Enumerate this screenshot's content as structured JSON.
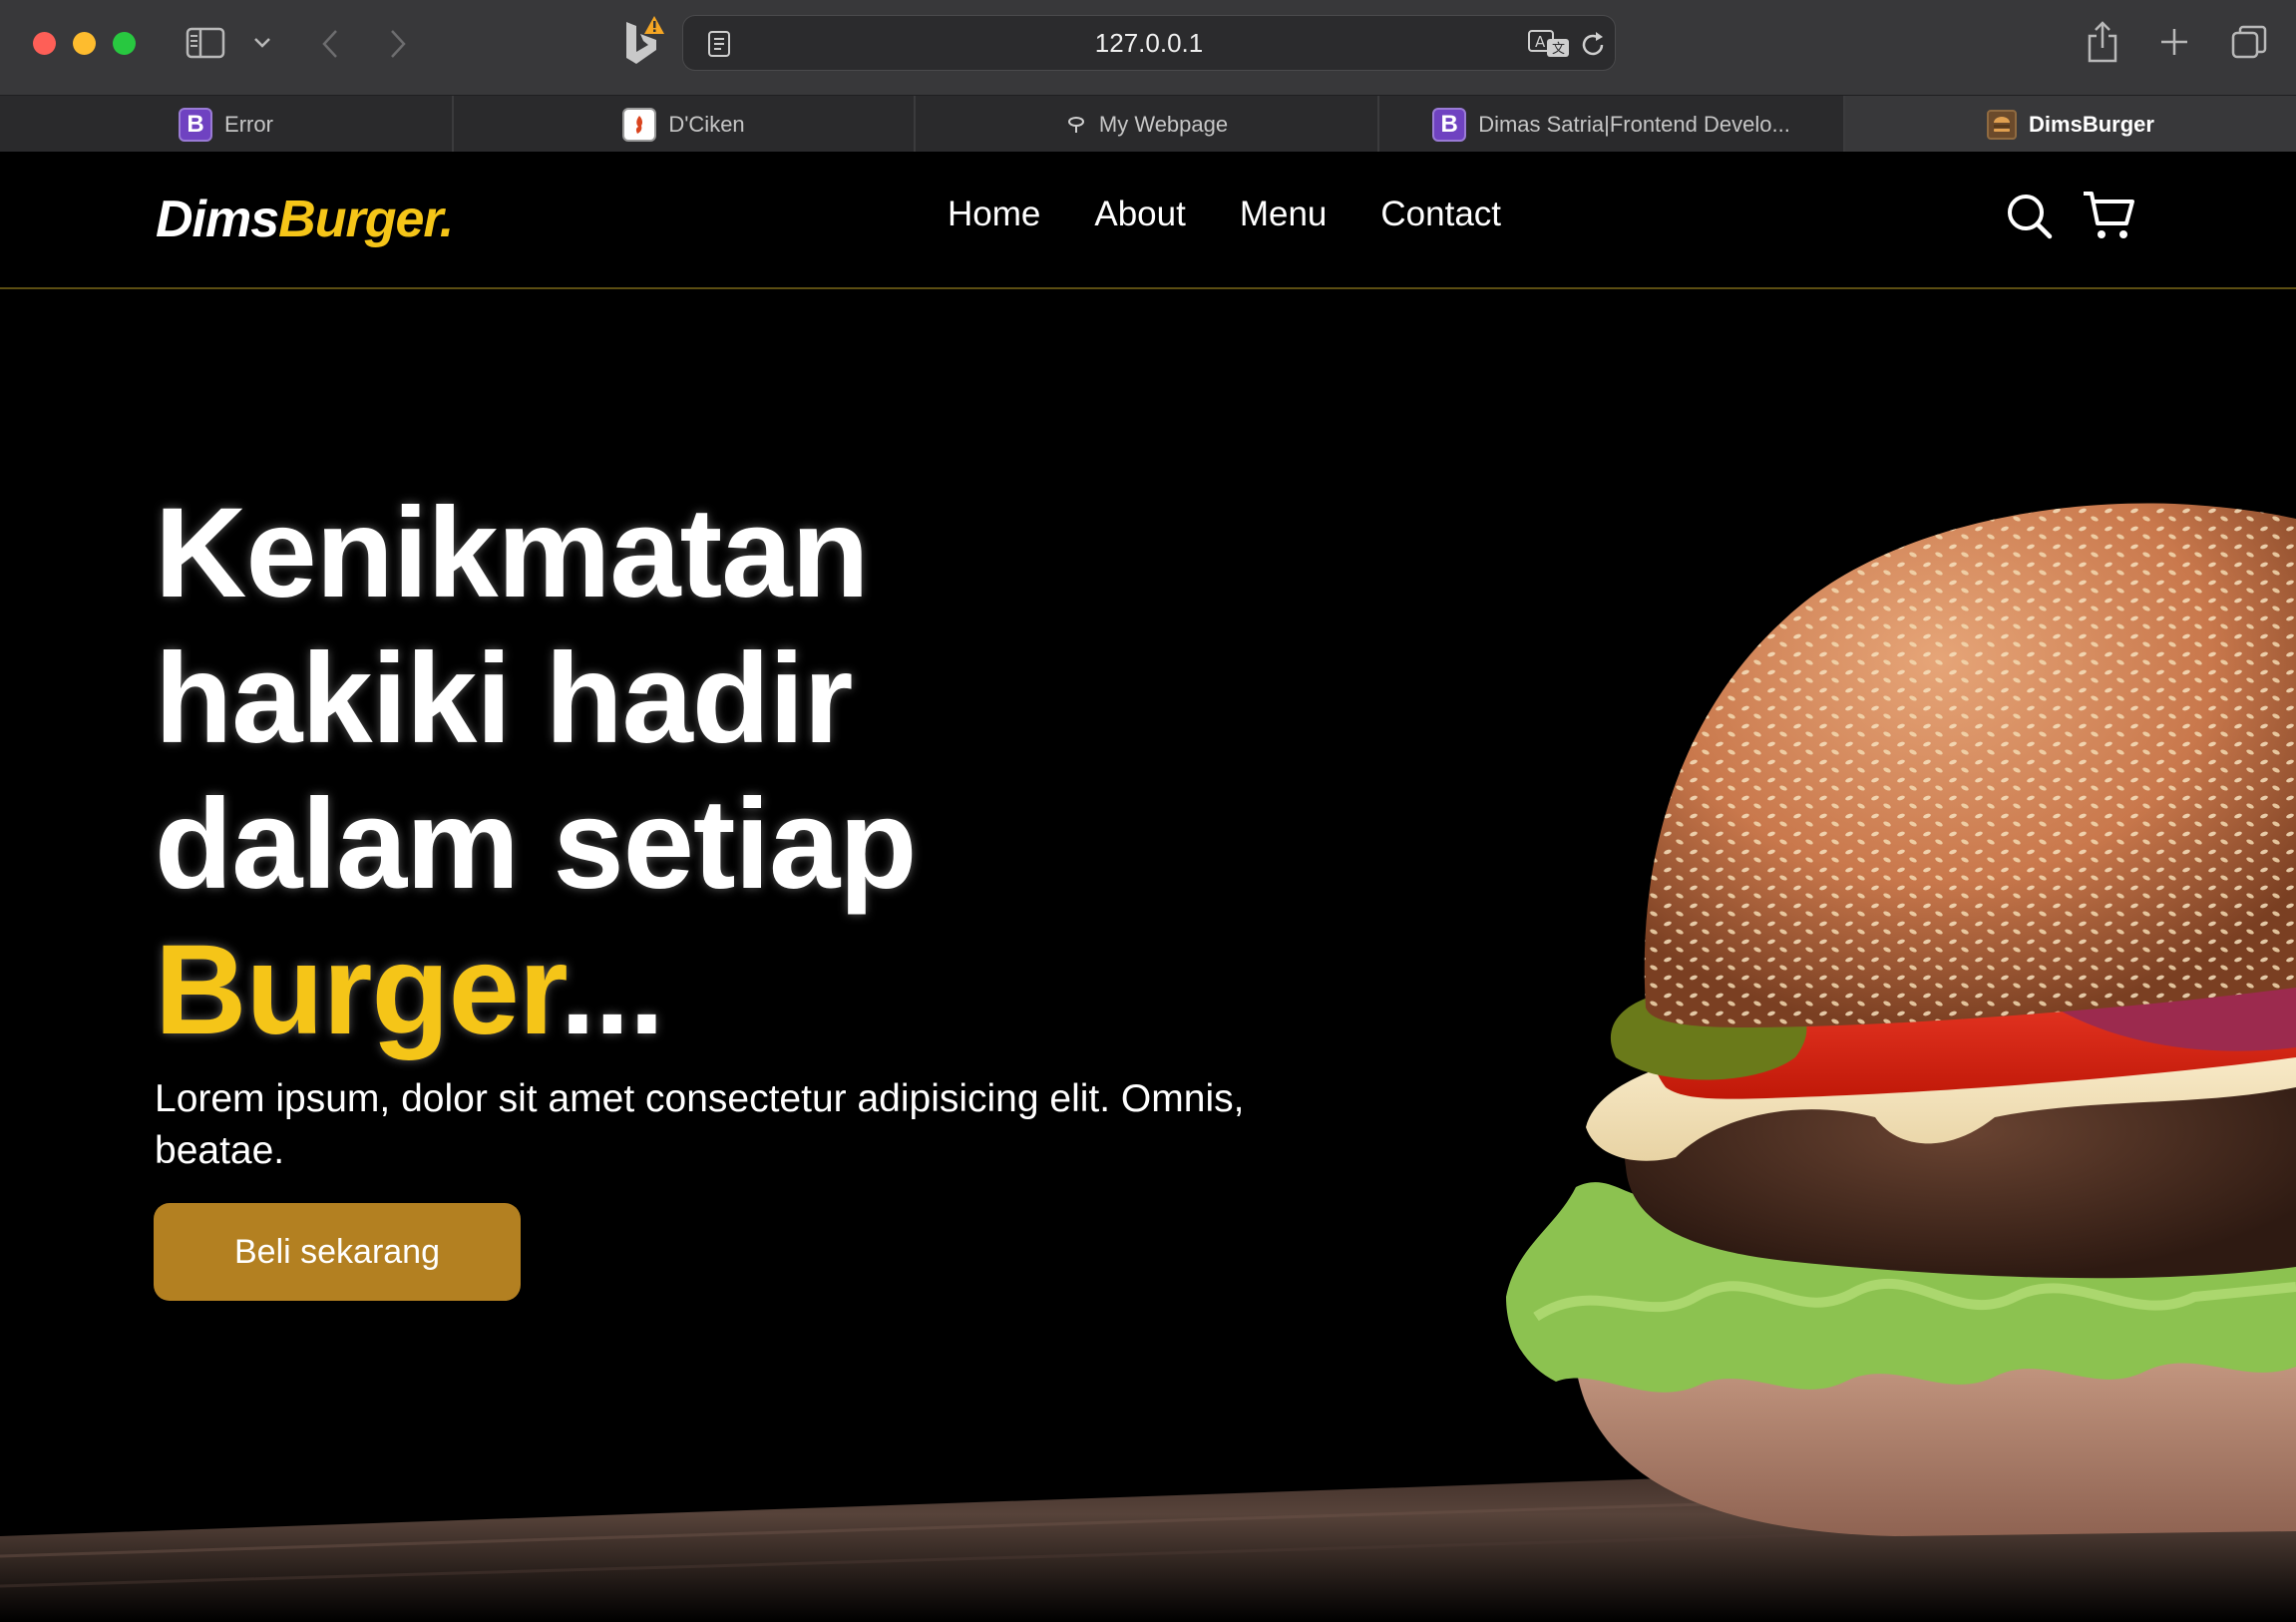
{
  "browser": {
    "url": "127.0.0.1",
    "tabs": [
      {
        "title": "Error",
        "favicon": "bootstrap-b-icon"
      },
      {
        "title": "D'Ciken",
        "favicon": "chicken-icon"
      },
      {
        "title": "My Webpage",
        "favicon": "webpage-icon"
      },
      {
        "title": "Dimas Satria|Frontend Develo...",
        "favicon": "bootstrap-b-icon"
      },
      {
        "title": "DimsBurger",
        "favicon": "burger-icon",
        "active": true
      }
    ],
    "favicon_b_letter": "B"
  },
  "site": {
    "logo": {
      "part1": "Dims",
      "part2": "Burger."
    },
    "nav": [
      "Home",
      "About",
      "Menu",
      "Contact"
    ],
    "hero": {
      "line1": "Kenikmatan",
      "line2": "hakiki hadir",
      "line3": "dalam setiap",
      "highlight": "Burger",
      "ellipsis": "...",
      "subtitle": "Lorem ipsum, dolor sit amet consectetur adipisicing elit. Omnis, beatae.",
      "cta": "Beli sekarang"
    },
    "colors": {
      "accent": "#f5c518",
      "button": "#b38021",
      "background": "#000000"
    }
  }
}
